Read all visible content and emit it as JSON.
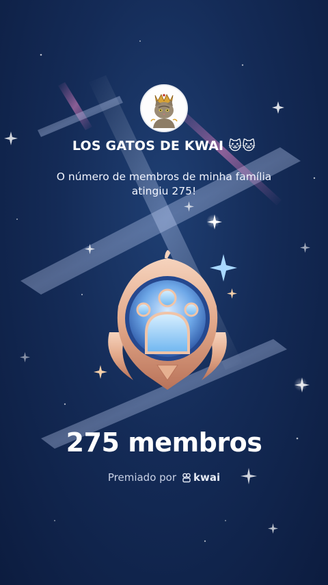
{
  "family": {
    "name": "LOS GATOS DE KWAI 🐱🐱",
    "avatar_icon": "cat-king-icon"
  },
  "message": "O número de membros de minha família atingiu 275!",
  "badge": {
    "icon": "family-members-badge-icon",
    "colors": {
      "rim": "#e7b08f",
      "inner": "#6ea8e8",
      "accent": "#a9d8ff"
    }
  },
  "member_count_label": "275 membros",
  "award": {
    "prefix": "Premiado por",
    "brand": "kwai",
    "brand_icon": "kwai-logo-icon"
  },
  "colors": {
    "background": "#142b57",
    "text": "#ffffff",
    "muted": "#c9d2e6"
  }
}
